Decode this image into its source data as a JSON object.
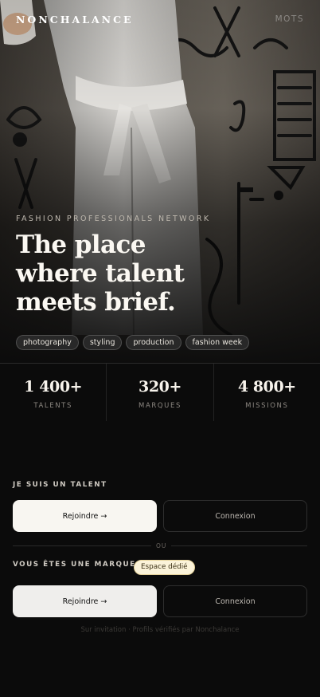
{
  "header": {
    "brand": "NONCHALANCE",
    "nav_link": "MOTS"
  },
  "hero": {
    "kicker": "FASHION PROFESSIONALS NETWORK",
    "headline_lines": [
      "The place",
      "where talent",
      "meets brief."
    ],
    "tags": [
      "photography",
      "styling",
      "production",
      "fashion week"
    ]
  },
  "stats": [
    {
      "value": "1 400+",
      "label": "TALENTS"
    },
    {
      "value": "320+",
      "label": "MARQUES"
    },
    {
      "value": "4 800+",
      "label": "MISSIONS"
    }
  ],
  "talent": {
    "label": "JE SUIS UN TALENT",
    "join": "Rejoindre →",
    "login": "Connexion"
  },
  "divider": "OU",
  "brand_section": {
    "label": "VOUS ÊTES UNE MARQUE ?",
    "badge": "Espace dédié",
    "join": "Rejoindre →",
    "login": "Connexion"
  },
  "footnote": "Sur invitation · Profils vérifiés par Nonchalance",
  "colors": {
    "background": "#0b0b0b",
    "primary_button": "#f8f6f1",
    "badge_bg": "#fbf3d9"
  },
  "icons": [
    "arrow-right-icon"
  ]
}
